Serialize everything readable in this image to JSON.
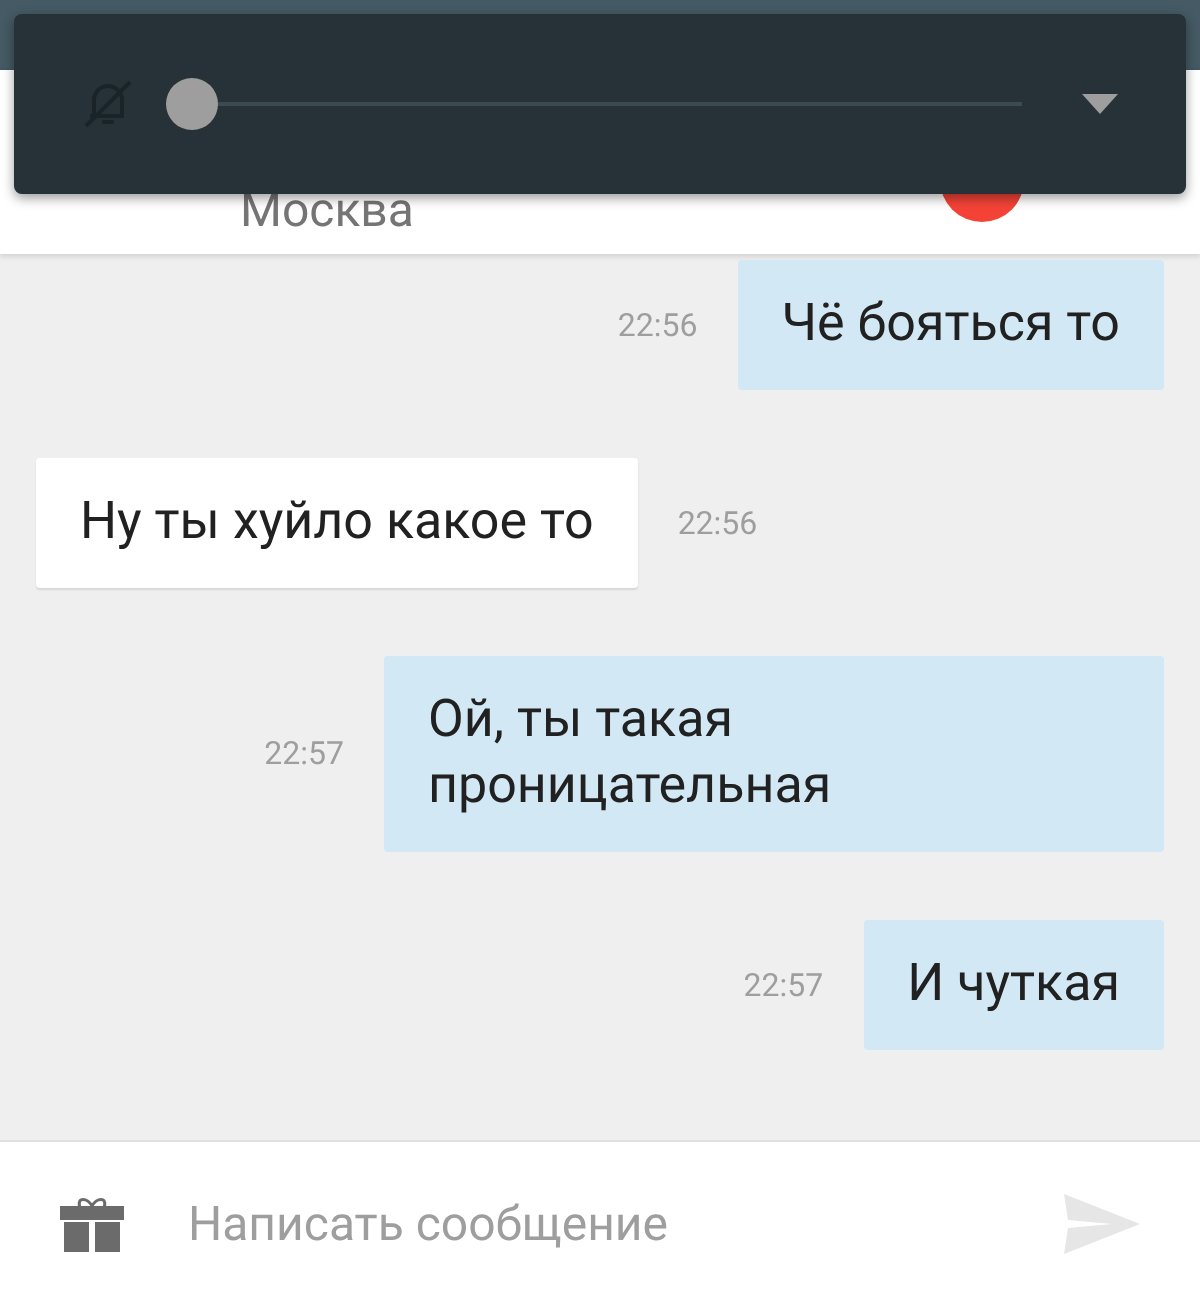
{
  "volume_panel": {
    "slider": {
      "level": 0
    }
  },
  "header": {
    "subtitle": "Москва"
  },
  "messages": [
    {
      "kind": "outgoing",
      "text": "Чё бояться то",
      "time": "22:56"
    },
    {
      "kind": "incoming",
      "text": "Ну ты хуйло какое то",
      "time": "22:56"
    },
    {
      "kind": "outgoing",
      "text": "Ой, ты такая проницательная",
      "time": "22:57"
    },
    {
      "kind": "outgoing",
      "text": "И чуткая",
      "time": "22:57"
    }
  ],
  "composer": {
    "placeholder": "Написать сообщение"
  }
}
